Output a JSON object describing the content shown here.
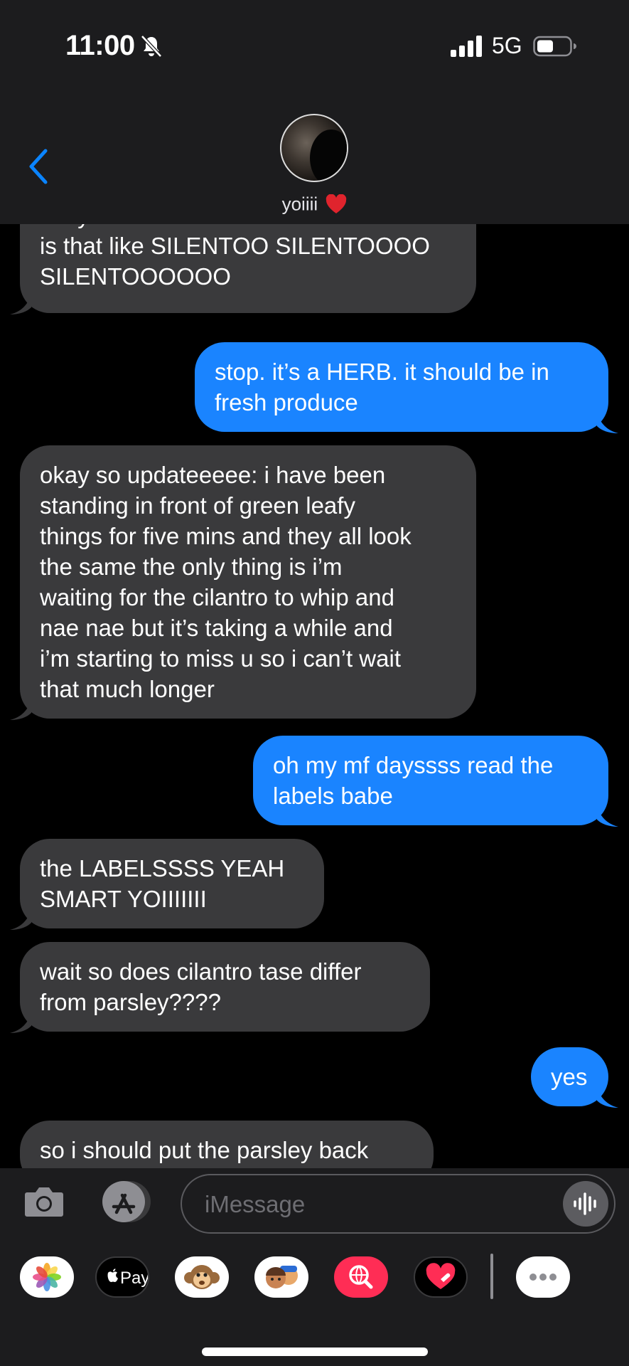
{
  "status_bar": {
    "time": "11:00",
    "network": "5G"
  },
  "contact": {
    "name": "yoiiii"
  },
  "messages": [
    {
      "direction": "incoming",
      "lines": [
        "okay boiiiiii done now i need cilantro",
        "is that like SILENTOO SILENTOOOO",
        "SILENTOOOOOO"
      ]
    },
    {
      "direction": "outgoing",
      "lines": [
        "stop. it’s a HERB. it should be in",
        "fresh produce"
      ]
    },
    {
      "direction": "incoming",
      "lines": [
        "okay so updateeeee: i have been",
        "standing in front of green leafy",
        "things for five mins and they all look",
        "the same the only thing is i’m",
        "waiting for the cilantro to whip and",
        "nae nae but it’s taking a while and",
        "i’m starting to miss u so i can’t wait",
        "that much longer"
      ]
    },
    {
      "direction": "outgoing",
      "lines": [
        "oh my mf dayssss read the",
        "labels babe"
      ]
    },
    {
      "direction": "incoming",
      "lines": [
        "the LABELSSSS YEAH",
        "SMART YOIIIIIII"
      ]
    },
    {
      "direction": "incoming",
      "lines": [
        "wait so does cilantro tase differ",
        "from parsley????"
      ]
    },
    {
      "direction": "outgoing",
      "lines": [
        "yes"
      ]
    },
    {
      "direction": "incoming",
      "lines": [
        "so i should put the parsley back"
      ]
    }
  ],
  "input": {
    "placeholder": "iMessage"
  },
  "app_drawer": {
    "items": [
      {
        "name": "photos-app-icon"
      },
      {
        "name": "apple-pay-app-icon",
        "label": "Pay"
      },
      {
        "name": "animoji-app-icon"
      },
      {
        "name": "memoji-app-icon"
      },
      {
        "name": "image-search-app-icon"
      },
      {
        "name": "digital-touch-app-icon"
      },
      {
        "name": "more-apps-icon"
      }
    ]
  },
  "colors": {
    "incoming_bubble": "#3a3a3c",
    "outgoing_bubble": "#1a84ff",
    "header_bg": "#1c1c1e",
    "accent": "#0a84ff"
  }
}
